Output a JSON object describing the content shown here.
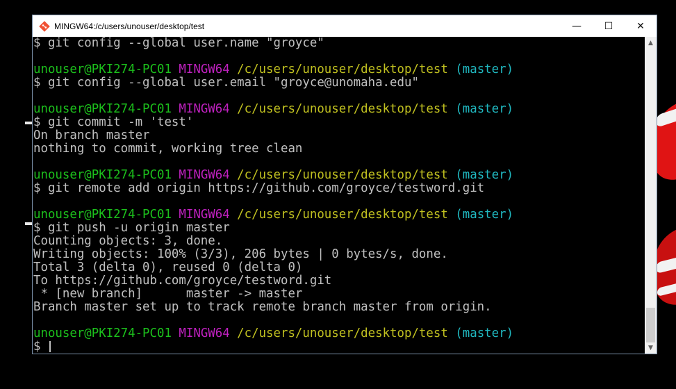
{
  "window": {
    "title": "MINGW64:/c/users/unouser/desktop/test",
    "icon": "git-bash-icon",
    "controls": {
      "minimize": "—",
      "maximize": "☐",
      "close": "✕"
    }
  },
  "terminal": {
    "lines": [
      [
        {
          "t": "$ git config --global user.name \"groyce\"",
          "c": "white"
        }
      ],
      [],
      [
        {
          "t": "unouser@PKI274-PC01 ",
          "c": "green"
        },
        {
          "t": "MINGW64 ",
          "c": "magenta"
        },
        {
          "t": "/c/users/unouser/desktop/test ",
          "c": "yellow"
        },
        {
          "t": "(master)",
          "c": "cyan"
        }
      ],
      [
        {
          "t": "$ git config --global user.email \"groyce@unomaha.edu\"",
          "c": "white"
        }
      ],
      [],
      [
        {
          "t": "unouser@PKI274-PC01 ",
          "c": "green"
        },
        {
          "t": "MINGW64 ",
          "c": "magenta"
        },
        {
          "t": "/c/users/unouser/desktop/test ",
          "c": "yellow"
        },
        {
          "t": "(master)",
          "c": "cyan"
        }
      ],
      [
        {
          "t": "$ git commit -m 'test'",
          "c": "white"
        }
      ],
      [
        {
          "t": "On branch master",
          "c": "white"
        }
      ],
      [
        {
          "t": "nothing to commit, working tree clean",
          "c": "white"
        }
      ],
      [],
      [
        {
          "t": "unouser@PKI274-PC01 ",
          "c": "green"
        },
        {
          "t": "MINGW64 ",
          "c": "magenta"
        },
        {
          "t": "/c/users/unouser/desktop/test ",
          "c": "yellow"
        },
        {
          "t": "(master)",
          "c": "cyan"
        }
      ],
      [
        {
          "t": "$ git remote add origin https://github.com/groyce/testword.git",
          "c": "white"
        }
      ],
      [],
      [
        {
          "t": "unouser@PKI274-PC01 ",
          "c": "green"
        },
        {
          "t": "MINGW64 ",
          "c": "magenta"
        },
        {
          "t": "/c/users/unouser/desktop/test ",
          "c": "yellow"
        },
        {
          "t": "(master)",
          "c": "cyan"
        }
      ],
      [
        {
          "t": "$ git push -u origin master",
          "c": "white"
        }
      ],
      [
        {
          "t": "Counting objects: 3, done.",
          "c": "white"
        }
      ],
      [
        {
          "t": "Writing objects: 100% (3/3), 206 bytes | 0 bytes/s, done.",
          "c": "white"
        }
      ],
      [
        {
          "t": "Total 3 (delta 0), reused 0 (delta 0)",
          "c": "white"
        }
      ],
      [
        {
          "t": "To https://github.com/groyce/testword.git",
          "c": "white"
        }
      ],
      [
        {
          "t": " * [new branch]      master -> master",
          "c": "white"
        }
      ],
      [
        {
          "t": "Branch master set up to track remote branch master from origin.",
          "c": "white"
        }
      ],
      [],
      [
        {
          "t": "unouser@PKI274-PC01 ",
          "c": "green"
        },
        {
          "t": "MINGW64 ",
          "c": "magenta"
        },
        {
          "t": "/c/users/unouser/desktop/test ",
          "c": "yellow"
        },
        {
          "t": "(master)",
          "c": "cyan"
        }
      ],
      [
        {
          "t": "$ ",
          "c": "white"
        }
      ]
    ],
    "colors": {
      "green": "#1cc01c",
      "magenta": "#c021c0",
      "yellow": "#c0c020",
      "cyan": "#20b8c0",
      "white": "#c0c0c0",
      "background": "#000000"
    }
  },
  "scrollbar": {
    "up_icon": "▲",
    "down_icon": "▼"
  }
}
